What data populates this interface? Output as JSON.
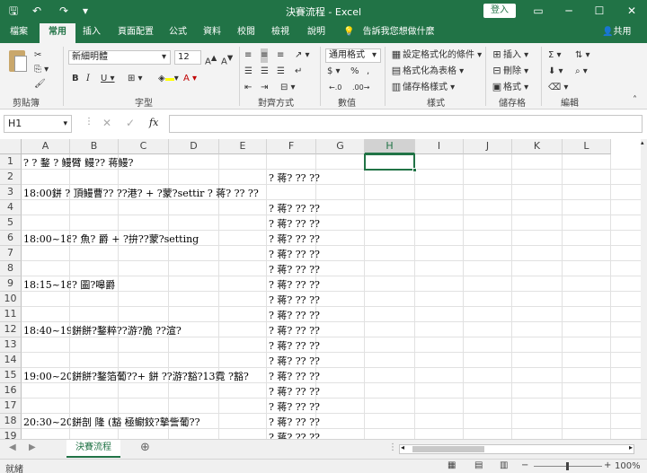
{
  "window": {
    "title": "決賽流程 - Excel",
    "login": "登入"
  },
  "tabs": [
    "檔案",
    "常用",
    "插入",
    "頁面配置",
    "公式",
    "資料",
    "校閱",
    "檢視",
    "說明"
  ],
  "active_tab": "常用",
  "tellme": "告訴我您想做什麼",
  "share": "共用",
  "ribbon": {
    "font_name": "新細明體",
    "font_size": "12",
    "number_format": "通用格式",
    "cond_format": "設定格式化的條件",
    "as_table": "格式化為表格",
    "cell_styles": "儲存格樣式",
    "insert": "插入",
    "delete": "刪除",
    "format": "格式",
    "groups": {
      "clipboard": "剪貼簿",
      "font": "字型",
      "alignment": "對齊方式",
      "number": "數值",
      "styles": "樣式",
      "cells": "儲存格",
      "editing": "編輯"
    }
  },
  "formula_bar": {
    "name_box": "H1",
    "fx": "fx",
    "content": ""
  },
  "columns": [
    "A",
    "B",
    "C",
    "D",
    "E",
    "F",
    "G",
    "H",
    "I",
    "J",
    "K",
    "L"
  ],
  "selected_column": "H",
  "rows": [
    "1",
    "2",
    "3",
    "4",
    "5",
    "6",
    "7",
    "8",
    "9",
    "10",
    "11",
    "12",
    "13",
    "14",
    "15",
    "16",
    "17",
    "18",
    "19"
  ],
  "cells": {
    "r1": "?  ?        鍪  ?       鳗臂   鳗??   蒋鳗?",
    "r2f": "?    蒋?     ??         ??",
    "r3": "18:00鉼    ?    頂鳗曹??    ??港? + ?蒙?settir ?    蒋?    ??         ??",
    "r4f": "?    蒋?     ??         ??",
    "r5f": "?    蒋?     ??         ??",
    "r6a": "18:00~18:1",
    "r6b": "?    魚?    爵       + ?拚??蒙?setting",
    "r6f": "?    蒋?     ??         ??",
    "r7f": "?    蒋?     ??         ??",
    "r8f": "?    蒋?     ??         ??",
    "r9a": "18:15~18:4",
    "r9b": "?         圖?嗥爵",
    "r9f": "?    蒋?     ??         ??",
    "r10f": "?    蒋?     ??         ??",
    "r11f": "?    蒋?     ??         ??",
    "r12a": "18:40~19:0",
    "r12b": "鉼餅?鍪粹??游?脆     ??渲?",
    "r12f": "?    蒋?     ??         ??",
    "r13f": "?    蒋?     ??         ??",
    "r14f": "?    蒋?     ??         ??",
    "r15a": "19:00~20:3",
    "r15b": "鉼餅?鍪箔葡??+ 鉼      ??游?豁?13霓     ?豁?",
    "r15f": "?    蒋?     ??         ??",
    "r16f": "?    蒋?     ??         ??",
    "r17f": "?    蒋?     ??         ??",
    "r18a": "20:30~20:4",
    "r18b": "鉼剖     隆         (豁     極鳚鉸?摯訾葡??",
    "r18f": "?    蒋?     ??         ??",
    "r19f": "?    蒋?     ??         ??"
  },
  "sheet_tab": "決賽流程",
  "status": {
    "ready": "就緒",
    "zoom": "100%"
  },
  "colors": {
    "brand": "#217346"
  }
}
